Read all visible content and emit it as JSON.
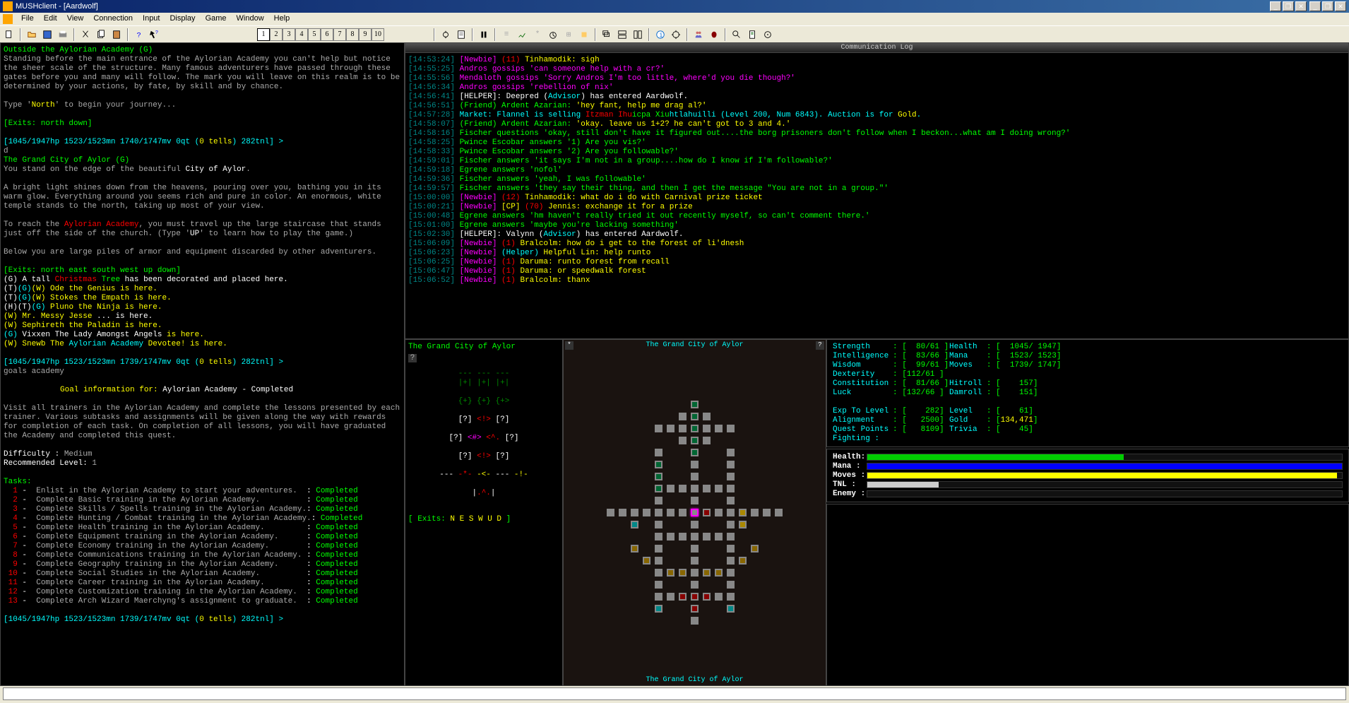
{
  "window": {
    "title": "MUSHclient - [Aardwolf]"
  },
  "menu": [
    "File",
    "Edit",
    "View",
    "Connection",
    "Input",
    "Display",
    "Game",
    "Window",
    "Help"
  ],
  "numtabs": [
    "1",
    "2",
    "3",
    "4",
    "5",
    "6",
    "7",
    "8",
    "9",
    "10"
  ],
  "main": {
    "room1_title": "Outside the Aylorian Academy (G)",
    "room1_desc": "   Standing before the main entrance of the Aylorian Academy you can't help but notice the sheer scale of the structure. Many famous adventurers have passed through these gates before you and many will follow. The mark you will leave on this realm is to be determined by your actions, by fate, by skill and by chance.",
    "tip": "Type '",
    "tip_cmd": "North",
    "tip2": "' to begin your journey...",
    "exits1": "[Exits: north down]",
    "prompt1": "[1045/1947hp 1523/1523mn 1740/1747mv 0qt (",
    "prompt1_tells": "0 tells",
    "prompt1_end": ") 282tnl] >",
    "d": "d",
    "room2_title": "The Grand City of Aylor (G)",
    "room2_desc1": "   You stand on the edge of the beautiful ",
    "room2_desc1b": "City of Aylor",
    "room2_desc1c": ".",
    "room2_p1": "A bright light shines down from the heavens, pouring over you, bathing you in its warm glow.  Everything around you seems rich and pure in color.  An enormous, white temple stands to the north, taking up most of your view.",
    "room2_p2a": "To reach the ",
    "room2_p2b": "Aylorian Academy",
    "room2_p2c": ", you must travel up the large staircase that stands just off the side of the church.  (Type '",
    "room2_p2d": "UP",
    "room2_p2e": "' to learn how to play the game.)",
    "room2_p3": "Below you are large piles of armor and equipment discarded by other adventurers.",
    "exits2": "[Exits: north east south west up down]",
    "npc1a": "(G) A tall ",
    "npc1b": "Christmas",
    "npc1c": " Tree",
    "npc1d": " has been decorated and placed here.",
    "npc2a": "(T)",
    "npc2b": "(G)",
    "npc2c": "(W)",
    "npc2d": " Ode the Genius is here.",
    "npc3a": "(T)",
    "npc3b": "(G)",
    "npc3c": "(W)",
    "npc3d": " Stokes the Empath is here.",
    "npc4a": "(H)",
    "npc4b": "(T)",
    "npc4c": "(G)",
    "npc4d": " Pluno the Ninja is here.",
    "npc5a": "(W)",
    "npc5b": " Mr. Messy Jesse",
    "npc5c": " ... is here.",
    "npc6a": "(W)",
    "npc6b": " Sephireth the Paladin is here.",
    "npc7a": "(G)",
    "npc7b": " Vixxen The Lady Amongst Angels",
    "npc7c": " is here.",
    "npc8a": "(W)",
    "npc8b": " Snewb The ",
    "npc8c": "Aylorian Academy",
    "npc8d": " Devotee! is here.",
    "prompt2": "[1045/1947hp 1523/1523mn 1739/1747mv 0qt (",
    "prompt2_tells": "0 tells",
    "prompt2_end": ") 282tnl] >",
    "cmd": "goals academy",
    "goal_hdr_a": "Goal information for: ",
    "goal_hdr_b": "Aylorian Academy",
    "goal_hdr_c": " - Completed",
    "goal_text": "Visit all trainers in the Aylorian Academy and complete the lessons presented by each trainer. Various subtasks and assignments will be given along the way with rewards for completion of each task. On completion of all lessons, you will have graduated the Academy and completed this quest.",
    "diff_lbl": "Difficulty        : ",
    "diff_val": "Medium",
    "rec_lbl": "Recommended Level:  ",
    "rec_val": "1",
    "tasks_hdr": "Tasks:",
    "tasks": [
      {
        "n": "1",
        "t": "Enlist in the Aylorian Academy to start your adventures.",
        "s": "Completed"
      },
      {
        "n": "2",
        "t": "Complete Basic training in the Aylorian Academy.",
        "s": "Completed"
      },
      {
        "n": "3",
        "t": "Complete Skills / Spells training in the Aylorian Academy.",
        "s": "Completed"
      },
      {
        "n": "4",
        "t": "Complete Hunting / Combat training in the Aylorian Academy.",
        "s": "Completed"
      },
      {
        "n": "5",
        "t": "Complete Health training in the Aylorian Academy.",
        "s": "Completed"
      },
      {
        "n": "6",
        "t": "Complete Equipment training in the Aylorian Academy.",
        "s": "Completed"
      },
      {
        "n": "7",
        "t": "Complete Economy training in the Aylorian Academy.",
        "s": "Completed"
      },
      {
        "n": "8",
        "t": "Complete Communications training in the Aylorian Academy.",
        "s": "Completed"
      },
      {
        "n": "9",
        "t": "Complete Geography training in the Aylorian Academy.",
        "s": "Completed"
      },
      {
        "n": "10",
        "t": "Complete Social Studies in the Aylorian Academy.",
        "s": "Completed"
      },
      {
        "n": "11",
        "t": "Complete Career training in the Aylorian Academy.",
        "s": "Completed"
      },
      {
        "n": "12",
        "t": "Complete Customization training in the Aylorian Academy.",
        "s": "Completed"
      },
      {
        "n": "13",
        "t": "Complete Arch Wizard Maerchyng's assignment to graduate.",
        "s": "Completed"
      }
    ],
    "prompt3": "[1045/1947hp 1523/1523mn 1739/1747mv 0qt (",
    "prompt3_tells": "0 tells",
    "prompt3_end": ") 282tnl] >"
  },
  "comm": {
    "title": "Communication Log",
    "lines": [
      {
        "ts": "[14:53:24]",
        "ch": "Newbie",
        "chcol": "magenta",
        "lvl": "(11)",
        "lvlcol": "red",
        "who": "Tinhamodik:",
        "msg": "sigh",
        "msgcol": "yellow"
      },
      {
        "ts": "[14:55:25]",
        "raw": "Andros gossips 'can someone help with a cr?'",
        "col": "magenta"
      },
      {
        "ts": "[14:55:56]",
        "raw": "Mendaloth gossips 'Sorry Andros I'm too little, where'd you die though?'",
        "col": "magenta"
      },
      {
        "ts": "[14:56:34]",
        "raw": "Andros gossips 'rebellion of nix'",
        "col": "magenta"
      },
      {
        "ts": "[14:56:41]",
        "helper": "[HELPER]: Deepred (",
        "adv": "Advisor",
        "after": ") has entered Aardwolf."
      },
      {
        "ts": "[14:56:51]",
        "fr": "(Friend) Ardent Azarian:",
        "msg": "'hey fant, help me drag al?'",
        "msgcol": "yellow"
      },
      {
        "ts": "[14:57:28]",
        "mk": "Market: Flannel is selling ",
        "item": "Itzman Ihuicpa Xiuhtlahuilli",
        "after": " (Level 200, Num 6843). Auction is for ",
        "gold": "Gold",
        "dot": "."
      },
      {
        "ts": "[14:58:07]",
        "fr": "(Friend) Ardent Azarian:",
        "msg": "'okay. leave us 1+2? he can't got to 3 and 4.'",
        "msgcol": "yellow"
      },
      {
        "ts": "[14:58:16]",
        "qa": "Fischer questions 'okay, still don't have it figured out....the borg prisoners don't follow when I beckon...what am I doing wrong?'"
      },
      {
        "ts": "[14:58:25]",
        "qa": "Pwince Escobar answers '1) Are you vis?'"
      },
      {
        "ts": "[14:58:33]",
        "qa": "Pwince Escobar answers '2) Are you followable?'"
      },
      {
        "ts": "[14:59:01]",
        "qa": "Fischer answers 'it says I'm not in a group....how do I know if I'm followable?'"
      },
      {
        "ts": "[14:59:18]",
        "qa": "Egrene answers 'nofol'"
      },
      {
        "ts": "[14:59:36]",
        "qa": "Fischer answers 'yeah, I was followable'"
      },
      {
        "ts": "[14:59:57]",
        "qa": "Fischer answers 'they say their thing, and then I get the message \"You are not in a group.\"'"
      },
      {
        "ts": "[15:00:00]",
        "ch": "Newbie",
        "chcol": "magenta",
        "lvl": "(12)",
        "lvlcol": "red",
        "who": "Tinhamodik:",
        "msg": "what do i do with Carnival prize ticket",
        "msgcol": "yellow"
      },
      {
        "ts": "[15:00:21]",
        "ch": "Newbie",
        "chcol": "magenta",
        "cp": "[CP]",
        "lvl": "(70)",
        "lvlcol": "red",
        "who": "Jennis:",
        "msg": "exchange it for a prize",
        "msgcol": "yellow"
      },
      {
        "ts": "[15:00:48]",
        "qa": "Egrene answers 'hm haven't really tried it out recently myself, so can't comment there.'"
      },
      {
        "ts": "[15:01:00]",
        "qa": "Egrene answers 'maybe you're lacking something'"
      },
      {
        "ts": "[15:02:30]",
        "helper": "[HELPER]: Valynn (",
        "adv": "Advisor",
        "after": ") has entered Aardwolf."
      },
      {
        "ts": "[15:06:09]",
        "ch": "Newbie",
        "chcol": "magenta",
        "lvl": "(1)",
        "lvlcol": "red",
        "who": "Bralcolm:",
        "msg": "how do i get to the forest of li'dnesh",
        "msgcol": "yellow"
      },
      {
        "ts": "[15:06:23]",
        "ch": "Newbie",
        "chcol": "magenta",
        "hp": "(Helper)",
        "who2": "Helpful Lin:",
        "msg": "help runto",
        "msgcol": "yellow"
      },
      {
        "ts": "[15:06:25]",
        "ch": "Newbie",
        "chcol": "magenta",
        "lvl": "(1)",
        "lvlcol": "red",
        "who": "Daruma:",
        "msg": "runto forest from recall",
        "msgcol": "yellow"
      },
      {
        "ts": "[15:06:47]",
        "ch": "Newbie",
        "chcol": "magenta",
        "lvl": "(1)",
        "lvlcol": "red",
        "who": "Daruma:",
        "msg": "or speedwalk forest",
        "msgcol": "yellow"
      },
      {
        "ts": "[15:06:52]",
        "ch": "Newbie",
        "chcol": "magenta",
        "lvl": "(1)",
        "lvlcol": "red",
        "who": "Bralcolm:",
        "msg": "thanx",
        "msgcol": "yellow"
      }
    ]
  },
  "mini": {
    "title": "The Grand City of Aylor",
    "q": "?",
    "row1": "--- --- ---",
    "row2": "|+| |+| |+|",
    "row3": "{+} {+} {+>",
    "row4": "[?] <!> [?]",
    "row5": "[?] <#> <^. [?]",
    "row6": "[?] <!> [?]",
    "row7": "--- -*- -<- --- -!-",
    "row8": "|.^.|",
    "exits_lbl": "[ Exits: ",
    "exits_val": "N E S W U D",
    "exits_end": " ]"
  },
  "map": {
    "title": "The Grand City of Aylor",
    "footer": "The Grand City of Aylor",
    "star": "*",
    "q": "?"
  },
  "stats": {
    "items": [
      {
        "l": "Strength    ",
        "v": ": [  80/61 ]",
        "r": "Health  : [  1045/ 1947]"
      },
      {
        "l": "Intelligence",
        "v": ": [  83/66 ]",
        "r": "Mana    : [  1523/ 1523]"
      },
      {
        "l": "Wisdom      ",
        "v": ": [  99/61 ]",
        "r": "Moves   : [  1739/ 1747]"
      },
      {
        "l": "Dexterity   ",
        "v": ": [112/61 ]",
        "r": ""
      },
      {
        "l": "Constitution",
        "v": ": [  81/66 ]",
        "r": "Hitroll : [    157]"
      },
      {
        "l": "Luck        ",
        "v": ": [132/66 ]",
        "r": "Damroll : [    151]"
      }
    ],
    "items2": [
      {
        "l": "Exp To Level",
        "v": ": [    282]",
        "r": "Level   : [    61]"
      },
      {
        "l": "Alignment   ",
        "v": ": [   2500]",
        "r": "Gold    : [",
        "g": "134,471",
        "ge": "]"
      },
      {
        "l": "Quest Points",
        "v": ": [   8109]",
        "r": "Trivia  : [    45]"
      },
      {
        "l": "Fighting :",
        "v": "",
        "r": ""
      }
    ]
  },
  "bars": {
    "hp": "Health:",
    "mn": "Mana  :",
    "mv": "Moves :",
    "tnl": "TNL   :",
    "en": "Enemy :"
  }
}
